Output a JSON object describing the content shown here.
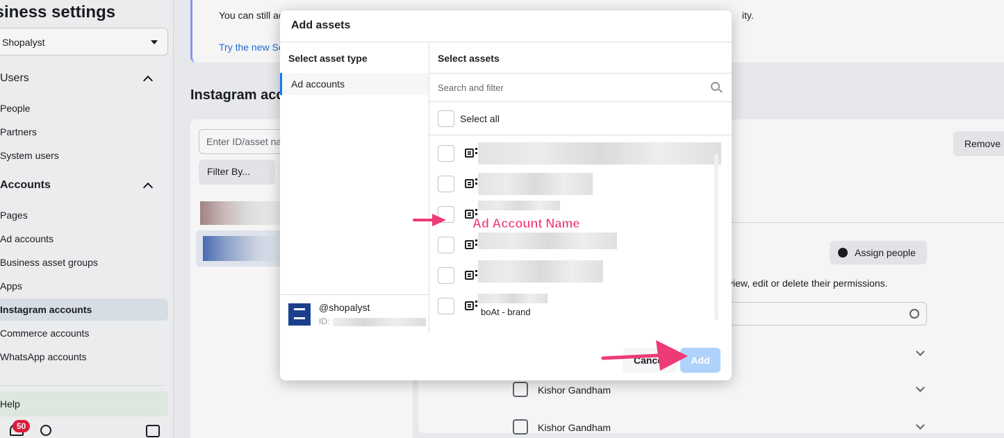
{
  "sidebar": {
    "title": "isiness settings",
    "business_select": "Shopalyst",
    "sections": [
      {
        "label": "Users",
        "items": [
          "People",
          "Partners",
          "System users"
        ]
      },
      {
        "label": "Accounts",
        "items": [
          "Pages",
          "Ad accounts",
          "Business asset groups",
          "Apps",
          "Instagram accounts",
          "Commerce accounts",
          "WhatsApp accounts"
        ]
      }
    ],
    "active_item": "Instagram accounts",
    "help": "Help",
    "notification_count": "50"
  },
  "banner": {
    "text": "You can still ac",
    "text_right": "ity.",
    "link": "Try the new Se"
  },
  "main": {
    "heading": "Instagram acco",
    "search_placeholder": "Enter ID/asset na",
    "filter_label": "Filter By...",
    "remove_button": "Remove",
    "assign_button": "Assign people",
    "description": "view, edit or delete their permissions.",
    "people": [
      "Kishor Gandham",
      "Kishor Gandham"
    ]
  },
  "modal": {
    "title": "Add assets",
    "asset_type_heading": "Select asset type",
    "asset_type_selected": "Ad accounts",
    "assets_heading": "Select assets",
    "search_placeholder": "Search and filter",
    "select_all": "Select all",
    "owner_name": "@shopalyst",
    "owner_id_label": "ID:",
    "last_row_visible_text": "boAt - brand",
    "cancel_button": "Cancel",
    "add_button": "Add"
  },
  "annotation": {
    "label": "Ad Account Name",
    "color": "#ee3b76"
  },
  "colors": {
    "primary": "#1877f2",
    "add_disabled": "#aed2fb",
    "badge": "#e41e3f",
    "link": "#216fdb"
  }
}
